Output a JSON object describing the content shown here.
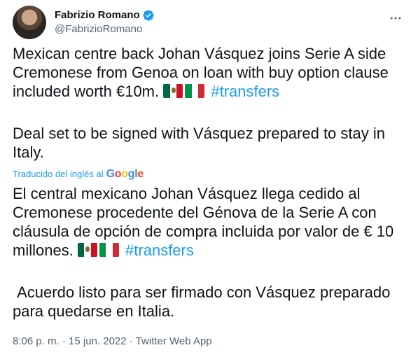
{
  "author": {
    "display_name": "Fabrizio Romano",
    "handle": "@FabrizioRomano"
  },
  "icons": {
    "verified": "verified-badge-icon",
    "more": "more-options-icon"
  },
  "colors": {
    "link": "#1d9bf0",
    "secondary": "#536471",
    "text": "#0f1419"
  },
  "tweet": {
    "p1_text": "Mexican centre back Johan Vásquez joins Serie A side Cremonese from Genoa on loan with buy option clause included worth €10m. ",
    "p1_hashtag": "#transfers",
    "p2_text": "Deal set to be signed with Vásquez prepared to stay in Italy.",
    "flags": [
      "Mexico flag",
      "Italy flag"
    ]
  },
  "translation": {
    "label": "Traducido del inglés al",
    "provider": "Google",
    "p1_text": "El central mexicano Johan Vásquez llega cedido al Cremonese procedente del Génova de la Serie A con cláusula de opción de compra incluida por valor de € 10 millones. ",
    "p1_hashtag": "#transfers",
    "p2_text": "Acuerdo listo para ser firmado con Vásquez preparado para quedarse en Italia."
  },
  "meta": {
    "time": "8:06 p. m.",
    "separator1": " · ",
    "date": "15 jun. 2022",
    "separator2": " · ",
    "source": "Twitter Web App"
  }
}
